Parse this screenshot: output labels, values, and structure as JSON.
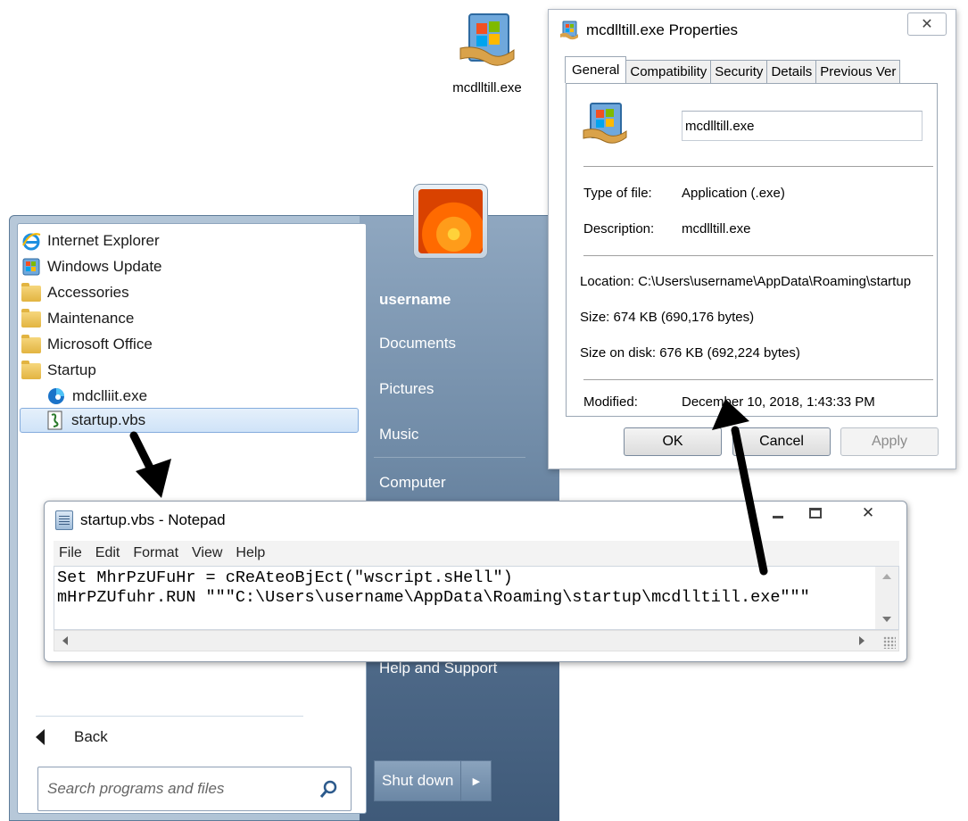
{
  "desktop": {
    "icon_label": "mcdlltill.exe"
  },
  "start_menu": {
    "programs": [
      {
        "label": "Internet Explorer",
        "icon": "internet-explorer-icon"
      },
      {
        "label": "Windows Update",
        "icon": "windows-update-icon"
      },
      {
        "label": "Accessories",
        "icon": "folder-icon"
      },
      {
        "label": "Maintenance",
        "icon": "folder-icon"
      },
      {
        "label": "Microsoft Office",
        "icon": "folder-icon"
      },
      {
        "label": "Startup",
        "icon": "folder-icon"
      },
      {
        "label": "mdclliit.exe",
        "icon": "edge-icon"
      },
      {
        "label": "startup.vbs",
        "icon": "script-icon"
      }
    ],
    "back_label": "Back",
    "search_placeholder": "Search programs and files",
    "right": {
      "user": "username",
      "documents": "Documents",
      "pictures": "Pictures",
      "music": "Music",
      "computer": "Computer",
      "help": "Help and Support"
    },
    "shutdown_label": "Shut down"
  },
  "properties": {
    "title": "mcdlltill.exe Properties",
    "tabs": [
      "General",
      "Compatibility",
      "Security",
      "Details",
      "Previous Ver"
    ],
    "filename": "mcdlltill.exe",
    "type_label": "Type of file:",
    "type_value": "Application (.exe)",
    "desc_label": "Description:",
    "desc_value": "mcdlltill.exe",
    "location_label": "Location:",
    "location_value": "C:\\Users\\username\\AppData\\Roaming\\startup",
    "size_label": "Size:",
    "size_value": "674 KB (690,176 bytes)",
    "size_disk_label": "Size on disk:",
    "size_disk_value": "676 KB (692,224 bytes)",
    "modified_label": "Modified:",
    "modified_value": "December 10, 2018, 1:43:33 PM",
    "ok": "OK",
    "cancel": "Cancel",
    "apply": "Apply"
  },
  "notepad": {
    "title": "startup.vbs - Notepad",
    "menu": [
      "File",
      "Edit",
      "Format",
      "View",
      "Help"
    ],
    "line1": "Set MhrPzUFuHr = cReAteoBjEct(\"wscript.sHell\")",
    "line2": "mHrPZUfuhr.RUN \"\"\"C:\\Users\\username\\AppData\\Roaming\\startup\\mcdlltill.exe\"\"\""
  }
}
